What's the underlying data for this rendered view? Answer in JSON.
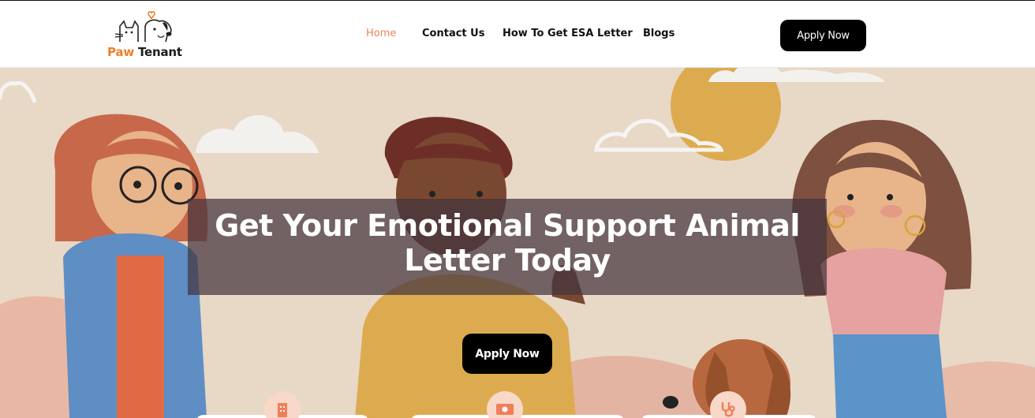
{
  "brand": {
    "paw": "Paw",
    "tenant": "Tenant"
  },
  "nav": {
    "links": [
      {
        "label": "Home",
        "active": true
      },
      {
        "label": "Contact Us",
        "active": false
      },
      {
        "label": "How To Get ESA Letter",
        "active": false
      },
      {
        "label": "Blogs",
        "active": false
      }
    ],
    "cta": "Apply Now"
  },
  "hero": {
    "headline_line1": "Get Your Emotional Support Animal",
    "headline_line2": "Letter Today",
    "cta": "Apply Now"
  },
  "features": [
    {
      "icon": "building-icon"
    },
    {
      "icon": "money-icon"
    },
    {
      "icon": "stethoscope-icon"
    }
  ],
  "colors": {
    "accent": "#e8845a",
    "brand_orange": "#f07e2a",
    "button": "#000000",
    "hero_bg": "#e8d8c6",
    "overlay": "#44343e"
  }
}
